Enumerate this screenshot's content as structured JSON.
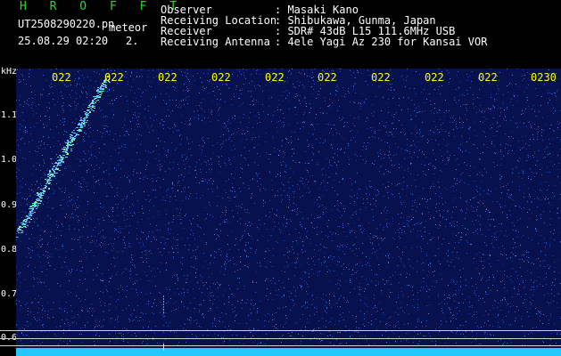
{
  "header": {
    "title": "H R O F F T",
    "filename": "UT2508290220.pn",
    "type_label": "meteor",
    "datetime": "25.08.29 02:20",
    "count": "2.",
    "fields": [
      {
        "label": "Observer",
        "value": ": Masaki Kano"
      },
      {
        "label": "Receiving Location",
        "value": ": Shibukawa, Gunma, Japan"
      },
      {
        "label": "Receiver",
        "value": ": SDR# 43dB L15 111.6MHz USB"
      },
      {
        "label": "Receiving Antenna",
        "value": ": 4ele Yagi Az 230 for Kansai VOR"
      }
    ]
  },
  "axis": {
    "unit": "kHz",
    "freq_labels": [
      "1.1",
      "1.0",
      "0.9",
      "0.8",
      "0.7",
      "0.6"
    ],
    "time_labels": [
      "022",
      "022",
      "022",
      "022",
      "022",
      "022",
      "022",
      "022",
      "022",
      "0230"
    ]
  },
  "colors": {
    "background": "#07114d",
    "title_green": "#2bd62b",
    "time_label_yellow": "#ffff00",
    "noise_band": "#22c8ff",
    "meteor_trace": "#4fc8ff"
  }
}
